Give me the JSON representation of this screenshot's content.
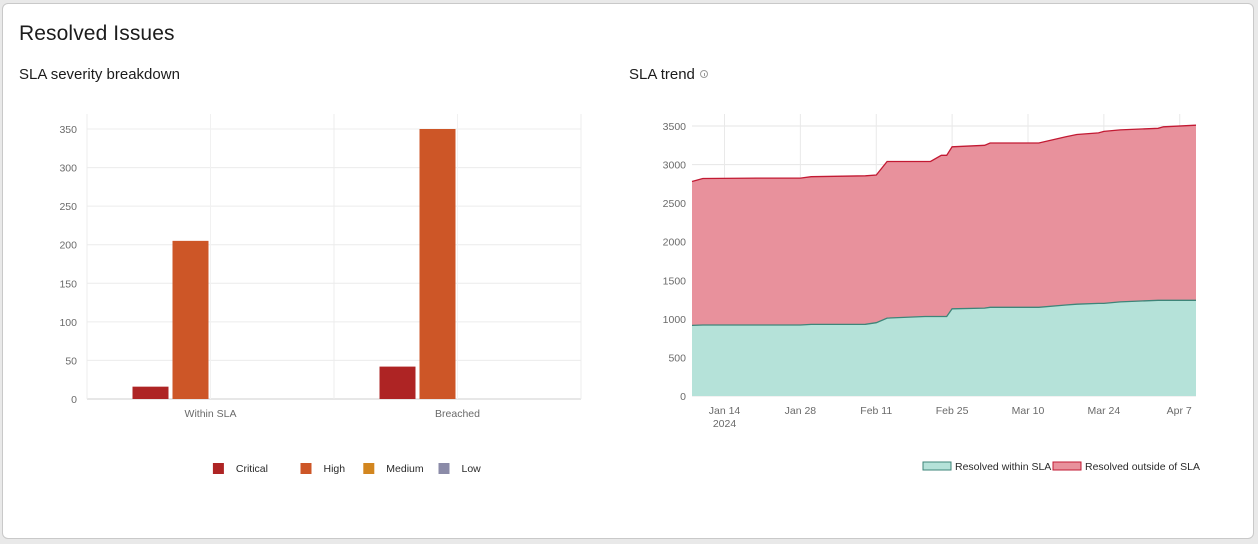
{
  "page": {
    "title": "Resolved Issues"
  },
  "chart_data": [
    {
      "type": "bar",
      "title": "SLA severity breakdown",
      "categories": [
        "Within SLA",
        "Breached"
      ],
      "series": [
        {
          "name": "Critical",
          "color": "#ae2424",
          "values": [
            16,
            42
          ]
        },
        {
          "name": "High",
          "color": "#cd5627",
          "values": [
            205,
            350
          ]
        },
        {
          "name": "Medium",
          "color": "#d2861f",
          "values": [
            0,
            0
          ]
        },
        {
          "name": "Low",
          "color": "#8b8ba8",
          "values": [
            0,
            0
          ]
        }
      ],
      "ylim": [
        0,
        350
      ],
      "yticks": [
        0,
        50,
        100,
        150,
        200,
        250,
        300,
        350
      ],
      "grid": true,
      "legend": "bottom"
    },
    {
      "type": "area",
      "stacked": true,
      "title": "SLA trend",
      "has_info_icon": true,
      "x": [
        "2024-01-08",
        "2024-01-10",
        "2024-01-20",
        "2024-01-28",
        "2024-01-30",
        "2024-02-09",
        "2024-02-11",
        "2024-02-13",
        "2024-02-20",
        "2024-02-21",
        "2024-02-23",
        "2024-02-24",
        "2024-02-25",
        "2024-03-02",
        "2024-03-03",
        "2024-03-11",
        "2024-03-12",
        "2024-03-17",
        "2024-03-19",
        "2024-03-23",
        "2024-03-24",
        "2024-03-27",
        "2024-04-03",
        "2024-04-04",
        "2024-04-10"
      ],
      "series": [
        {
          "name": "Resolved within SLA",
          "fill": "#b5e2d9",
          "line": "#3e8579",
          "values": [
            915,
            920,
            920,
            920,
            928,
            930,
            950,
            1010,
            1030,
            1030,
            1030,
            1030,
            1130,
            1140,
            1150,
            1150,
            1150,
            1180,
            1190,
            1200,
            1200,
            1220,
            1240,
            1240,
            1240
          ]
        },
        {
          "name": "Resolved outside of SLA",
          "fill": "#e8919c",
          "line": "#c21a33",
          "values": [
            1865,
            1900,
            1905,
            1905,
            1915,
            1925,
            1915,
            2030,
            2010,
            2010,
            2090,
            2090,
            2100,
            2110,
            2130,
            2130,
            2130,
            2180,
            2200,
            2210,
            2230,
            2230,
            2230,
            2250,
            2270
          ]
        }
      ],
      "x_tick_labels": [
        {
          "date": "2024-01-14",
          "label": "Jan 14",
          "sublabel": "2024"
        },
        {
          "date": "2024-01-28",
          "label": "Jan 28"
        },
        {
          "date": "2024-02-11",
          "label": "Feb 11"
        },
        {
          "date": "2024-02-25",
          "label": "Feb 25"
        },
        {
          "date": "2024-03-10",
          "label": "Mar 10"
        },
        {
          "date": "2024-03-24",
          "label": "Mar 24"
        },
        {
          "date": "2024-04-07",
          "label": "Apr 7"
        }
      ],
      "xlim": [
        "2024-01-08",
        "2024-04-10"
      ],
      "ylim": [
        0,
        3500
      ],
      "yticks": [
        0,
        500,
        1000,
        1500,
        2000,
        2500,
        3000,
        3500
      ],
      "grid": true,
      "legend": "bottom-right"
    }
  ]
}
